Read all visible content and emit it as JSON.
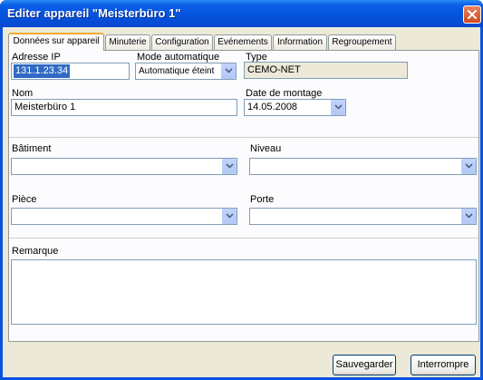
{
  "window": {
    "title": "Editer appareil \"Meisterbüro 1\""
  },
  "tabs": [
    {
      "label": "Données sur appareil",
      "active": true
    },
    {
      "label": "Minuterie",
      "active": false
    },
    {
      "label": "Configuration",
      "active": false
    },
    {
      "label": "Evénements",
      "active": false
    },
    {
      "label": "Information",
      "active": false
    },
    {
      "label": "Regroupement",
      "active": false
    }
  ],
  "form": {
    "ip": {
      "label": "Adresse IP",
      "value": "131.1.23.34"
    },
    "mode": {
      "label": "Mode automatique",
      "value": "Automatique éteint"
    },
    "type": {
      "label": "Type",
      "value": "CEMO-NET"
    },
    "name": {
      "label": "Nom",
      "value": "Meisterbüro 1"
    },
    "date": {
      "label": "Date de montage",
      "value": "14.05.2008"
    },
    "building": {
      "label": "Bâtiment",
      "value": ""
    },
    "level": {
      "label": "Niveau",
      "value": ""
    },
    "room": {
      "label": "Pièce",
      "value": ""
    },
    "door": {
      "label": "Porte",
      "value": ""
    },
    "remark": {
      "label": "Remarque",
      "value": ""
    }
  },
  "buttons": {
    "save": "Sauvegarder",
    "cancel": "Interrompre"
  },
  "colors": {
    "titlebar": "#0553dd",
    "tab_highlight": "#f5aa33",
    "selection": "#316ac5"
  }
}
